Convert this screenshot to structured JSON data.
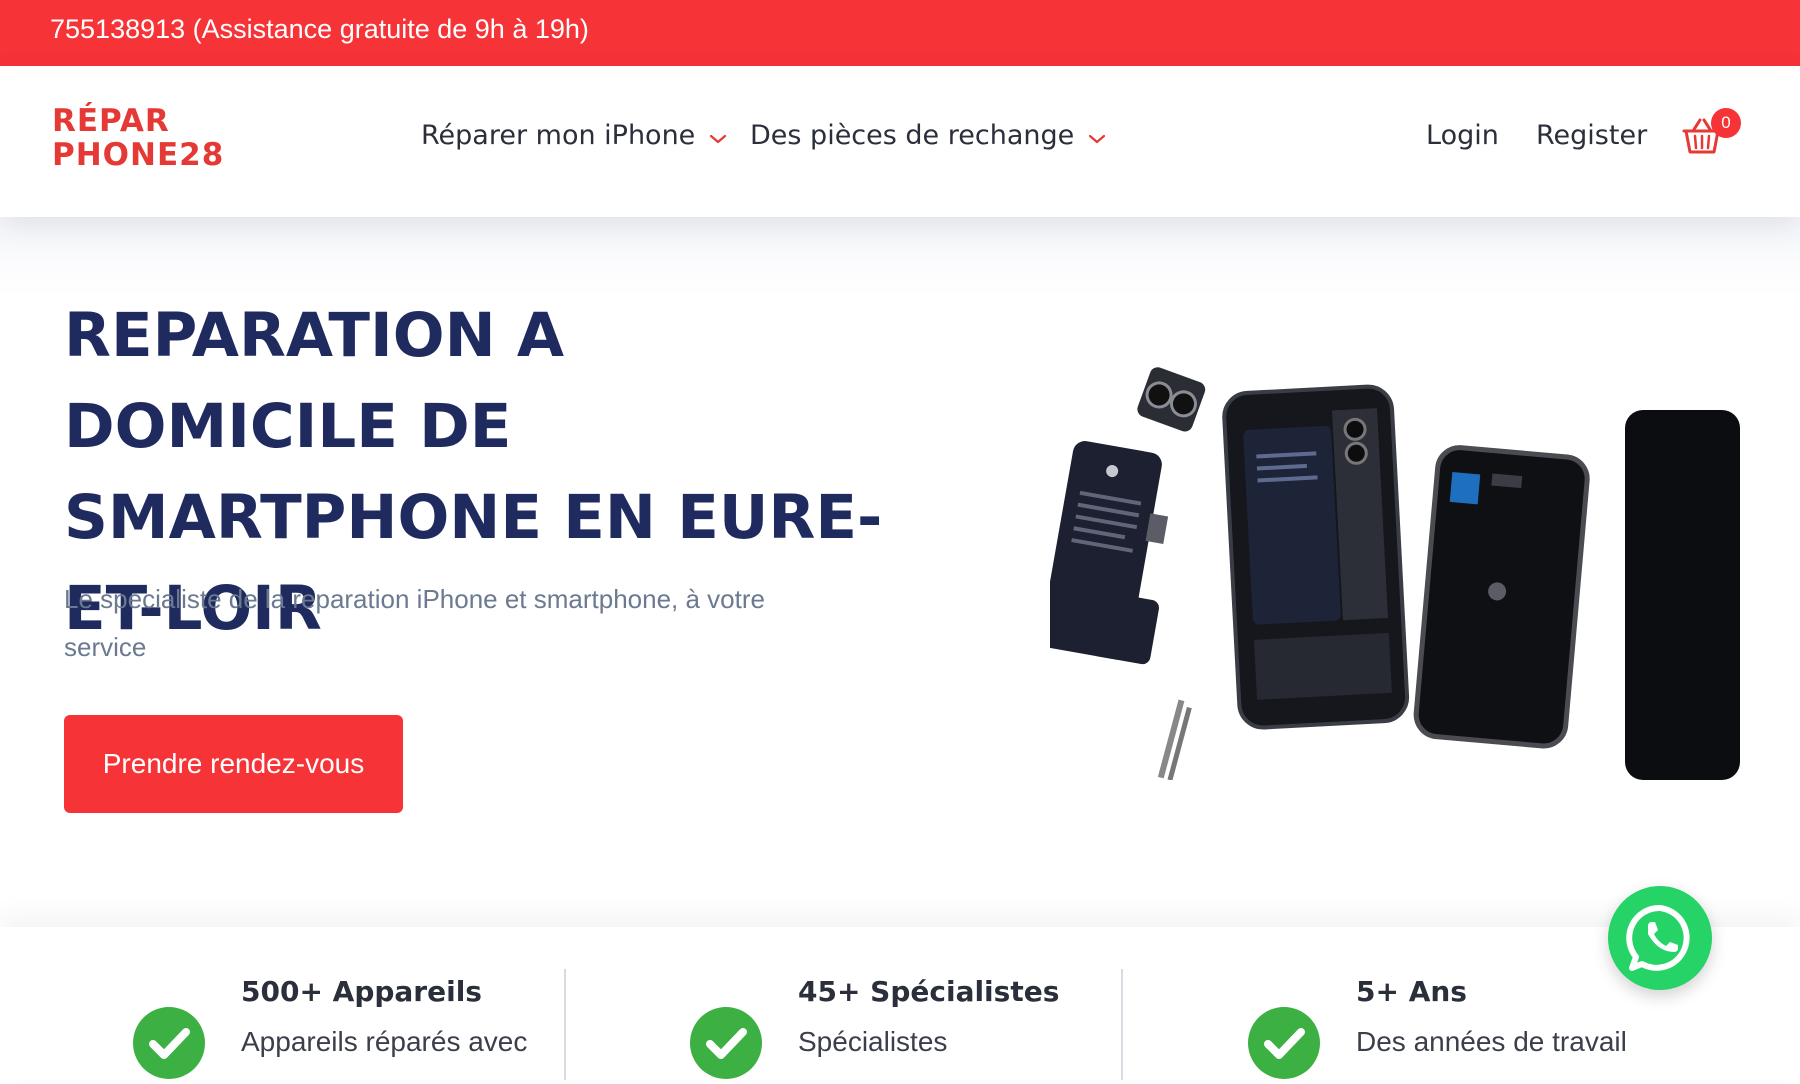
{
  "topbar": {
    "text": "755138913 (Assistance gratuite de 9h à 19h)"
  },
  "header": {
    "logo_line1": "RÉPAR",
    "logo_line2": "PHONE28",
    "nav": [
      {
        "label": "Réparer mon iPhone"
      },
      {
        "label": "Des pièces de rechange"
      }
    ],
    "login": "Login",
    "register": "Register",
    "cart_count": "0"
  },
  "hero": {
    "title": "REPARATION A DOMICILE DE SMARTPHONE EN EURE-ET-LOIR",
    "subtitle": "Le specialiste de la reparation iPhone et smartphone, à votre service",
    "cta": "Prendre rendez-vous"
  },
  "stats": [
    {
      "title": "500+ Appareils",
      "desc": "Appareils réparés avec"
    },
    {
      "title": "45+ Spécialistes",
      "desc": "Spécialistes"
    },
    {
      "title": "5+ Ans",
      "desc": "Des années de travail"
    }
  ],
  "colors": {
    "accent": "#f63337",
    "heading": "#1f2a5e",
    "check": "#3cb043",
    "whatsapp": "#25d366"
  },
  "icons": {
    "nav_chevron": "chevron-down-icon",
    "cart": "basket-icon",
    "stat_check": "check-circle-icon",
    "whatsapp": "whatsapp-icon"
  }
}
